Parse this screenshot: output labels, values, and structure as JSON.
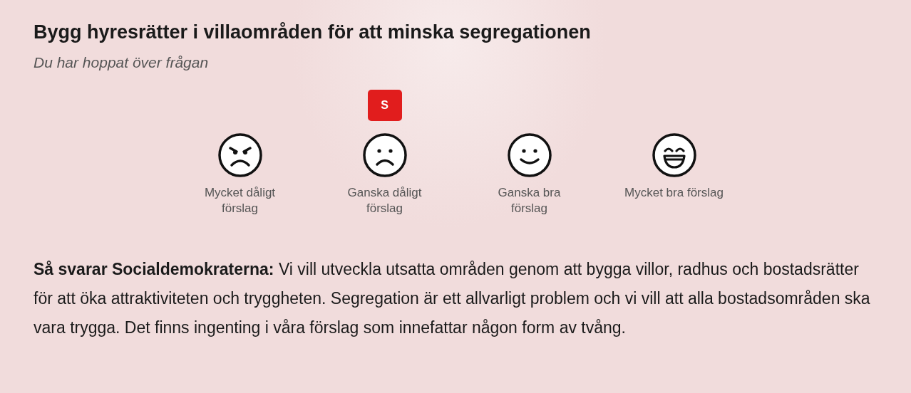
{
  "question": {
    "title": "Bygg hyresrätter i villaområden för att minska segregationen",
    "status": "Du har hoppat över frågan"
  },
  "options": [
    {
      "kind": "angry",
      "label": "Mycket dåligt förslag"
    },
    {
      "kind": "sad",
      "label": "Ganska dåligt förslag",
      "badge": "S"
    },
    {
      "kind": "smile",
      "label": "Ganska bra förslag"
    },
    {
      "kind": "laugh",
      "label": "Mycket bra förslag"
    }
  ],
  "answer": {
    "text": "**Så svarar Socialdemokraterna:** Vi vill utveckla utsatta områden genom att bygga villor, radhus och bostadsrätter för att öka attraktiviteten och tryggheten. Segregation är ett allvarligt problem och vi vill att alla bostadsområden ska vara trygga. Det finns ingenting i våra förslag som innefattar någon form av tvång."
  }
}
